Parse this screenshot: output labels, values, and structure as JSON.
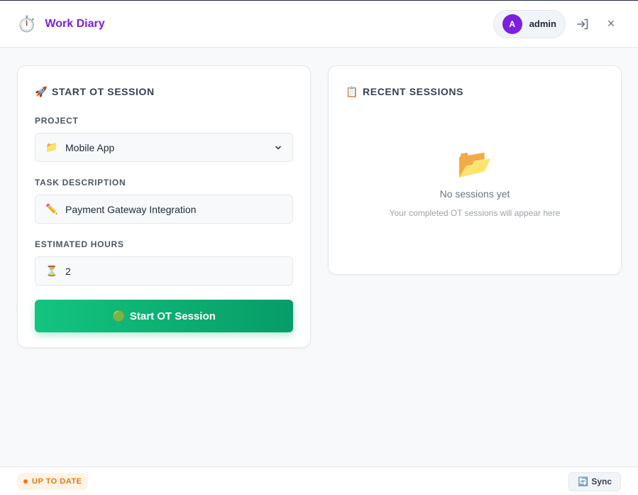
{
  "header": {
    "app_icon": "⏱️",
    "title": "Work Diary",
    "user": {
      "avatar_letter": "A",
      "name": "admin"
    },
    "logout_icon": "logout-icon",
    "close_label": "×"
  },
  "start_session": {
    "title_icon": "🚀",
    "title": "START OT SESSION",
    "project": {
      "label": "PROJECT",
      "icon": "📁",
      "value": "Mobile App"
    },
    "task": {
      "label": "TASK DESCRIPTION",
      "icon": "✏️",
      "value": "Payment Gateway Integration"
    },
    "hours": {
      "label": "ESTIMATED HOURS",
      "icon": "⏳",
      "value": "2"
    },
    "button": {
      "icon": "🟢",
      "label": "Start OT Session"
    }
  },
  "recent_sessions": {
    "title_icon": "📋",
    "title": "RECENT SESSIONS",
    "empty": {
      "icon": "📂",
      "title": "No sessions yet",
      "subtitle": "Your completed OT sessions will appear here"
    }
  },
  "footer": {
    "status": "UP TO DATE",
    "sync_icon": "🔄",
    "sync_label": "Sync"
  },
  "colors": {
    "brand": "#7c1fe0",
    "primary_button": "#10b981",
    "status_orange": "#f97316"
  }
}
